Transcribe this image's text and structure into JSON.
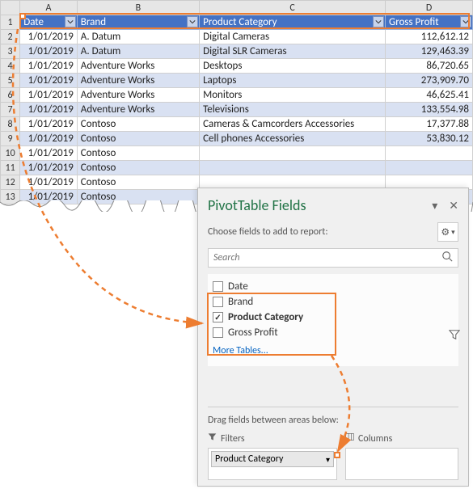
{
  "columns": {
    "A": "A",
    "B": "B",
    "C": "C",
    "D": "D"
  },
  "headers": {
    "date": "Date",
    "brand": "Brand",
    "category": "Product Category",
    "profit": "Gross Profit"
  },
  "rows": [
    {
      "n": "1"
    },
    {
      "n": "2",
      "date": "1/01/2019",
      "brand": "A. Datum",
      "cat": "Digital Cameras",
      "gp": "112,612.12"
    },
    {
      "n": "3",
      "date": "1/01/2019",
      "brand": "A. Datum",
      "cat": "Digital SLR Cameras",
      "gp": "129,463.39"
    },
    {
      "n": "4",
      "date": "1/01/2019",
      "brand": "Adventure Works",
      "cat": "Desktops",
      "gp": "86,720.65"
    },
    {
      "n": "5",
      "date": "1/01/2019",
      "brand": "Adventure Works",
      "cat": "Laptops",
      "gp": "273,909.70"
    },
    {
      "n": "6",
      "date": "1/01/2019",
      "brand": "Adventure Works",
      "cat": "Monitors",
      "gp": "46,625.41"
    },
    {
      "n": "7",
      "date": "1/01/2019",
      "brand": "Adventure Works",
      "cat": "Televisions",
      "gp": "133,554.98"
    },
    {
      "n": "8",
      "date": "1/01/2019",
      "brand": "Contoso",
      "cat": "Cameras & Camcorders Accessories",
      "gp": "17,377.88"
    },
    {
      "n": "9",
      "date": "1/01/2019",
      "brand": "Contoso",
      "cat": "Cell phones Accessories",
      "gp": "53,830.12"
    },
    {
      "n": "10",
      "date": "1/01/2019",
      "brand": "Contoso",
      "cat": "",
      "gp": ""
    },
    {
      "n": "11",
      "date": "1/01/2019",
      "brand": "Contoso",
      "cat": "",
      "gp": ""
    },
    {
      "n": "12",
      "date": "1/01/2019",
      "brand": "Contoso",
      "cat": "",
      "gp": ""
    },
    {
      "n": "13",
      "date": "1/01/2019",
      "brand": "Contoso",
      "cat": "",
      "gp": ""
    }
  ],
  "panel": {
    "title": "PivotTable Fields",
    "subtitle": "Choose fields to add to report:",
    "search_placeholder": "Search",
    "fields": {
      "date": "Date",
      "brand": "Brand",
      "category": "Product Category",
      "profit": "Gross Profit"
    },
    "more": "More Tables...",
    "drag": "Drag fields between areas below:",
    "area_filters": "Filters",
    "area_columns": "Columns",
    "filter_tag": "Product Category"
  },
  "colors": {
    "accent": "#ed7d31",
    "excel": "#217346",
    "headerbg": "#4472C4"
  }
}
